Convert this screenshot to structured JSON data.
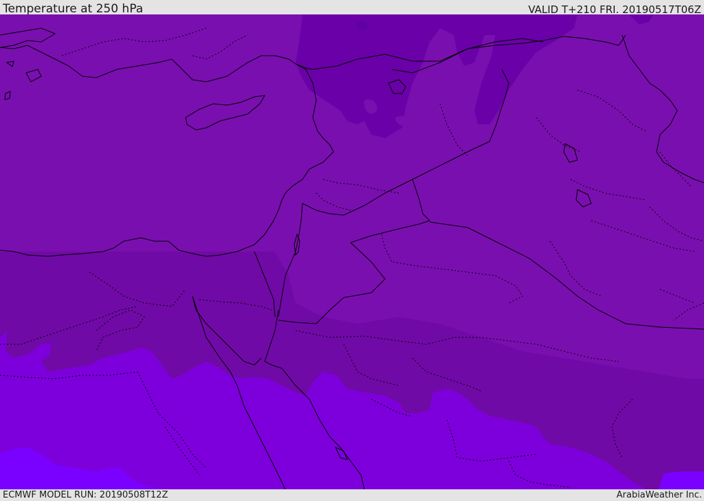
{
  "header": {
    "title": "Temperature at 250 hPa",
    "valid": "VALID T+210 FRI. 20190517T06Z"
  },
  "footer": {
    "model_run": "ECMWF MODEL RUN: 20190508T12Z",
    "credit": "ArabiaWeather Inc."
  },
  "map": {
    "field": "temperature-250hPa",
    "colors": {
      "darkest": "#5f00a0",
      "dark": "#6a00a8",
      "base": "#7a0fb0",
      "mid": "#700aa6",
      "light": "#7d00dc",
      "lightest": "#7a00ff",
      "coastline": "#000000",
      "border": "#000000",
      "provincial": "#000000"
    }
  }
}
